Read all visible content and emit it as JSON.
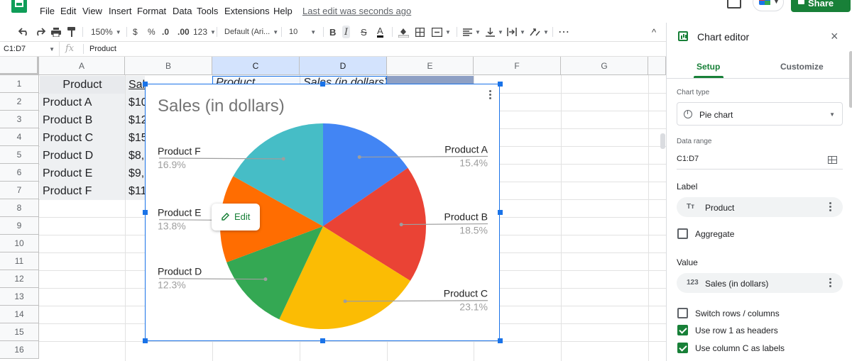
{
  "menubar": {
    "items": [
      "File",
      "Edit",
      "View",
      "Insert",
      "Format",
      "Data",
      "Tools",
      "Extensions",
      "Help"
    ],
    "last_edit": "Last edit was seconds ago",
    "share_label": "Share"
  },
  "toolbar": {
    "zoom": "150%",
    "currency": "$",
    "percent": "%",
    "decrease_decimal": ".0",
    "increase_decimal": ".00",
    "more_formats": "123",
    "font": "Default (Ari...",
    "font_size": "10",
    "bold": "B",
    "italic": "I",
    "strike": "S",
    "text_color": "A",
    "more": "⋯",
    "collapse": "^"
  },
  "formula": {
    "name_box": "C1:D7",
    "fx": "fx",
    "value": "Product"
  },
  "grid": {
    "columns": [
      "A",
      "B",
      "C",
      "D",
      "E",
      "F",
      "G"
    ],
    "rows": [
      "1",
      "2",
      "3",
      "4",
      "5",
      "6",
      "7",
      "8",
      "9",
      "10",
      "11",
      "12",
      "13",
      "14",
      "15",
      "16"
    ],
    "col_a": [
      "Product",
      "Product A",
      "Product B",
      "Product C",
      "Product D",
      "Product E",
      "Product F"
    ],
    "col_b": [
      "Sal",
      "$10",
      "$12",
      "$15",
      "$8,",
      "$9,",
      "$11"
    ],
    "c1": "Product",
    "d1": "Sales (in dollars)"
  },
  "chart": {
    "edit_label": "Edit",
    "colors": [
      "#4285f4",
      "#ea4335",
      "#fbbc04",
      "#34a853",
      "#ff6d01",
      "#46bdc6"
    ]
  },
  "chart_data": {
    "type": "pie",
    "title": "Sales (in dollars)",
    "categories": [
      "Product A",
      "Product B",
      "Product C",
      "Product D",
      "Product E",
      "Product F"
    ],
    "values": [
      15.4,
      18.5,
      23.1,
      12.3,
      13.8,
      16.9
    ],
    "value_labels": [
      "15.4%",
      "18.5%",
      "23.1%",
      "12.3%",
      "13.8%",
      "16.9%"
    ],
    "legend": "labeled"
  },
  "editor": {
    "title": "Chart editor",
    "close": "×",
    "tabs": [
      "Setup",
      "Customize"
    ],
    "chart_type_label": "Chart type",
    "chart_type": "Pie chart",
    "data_range_label": "Data range",
    "data_range": "C1:D7",
    "label_section": "Label",
    "label_chip": "Product",
    "label_chip_icon": "Tт",
    "aggregate": "Aggregate",
    "value_section": "Value",
    "value_chip": "Sales (in dollars)",
    "value_chip_icon": "123",
    "switch_rows": "Switch rows / columns",
    "use_row_headers": "Use row 1 as headers",
    "use_col_labels": "Use column C as labels"
  }
}
